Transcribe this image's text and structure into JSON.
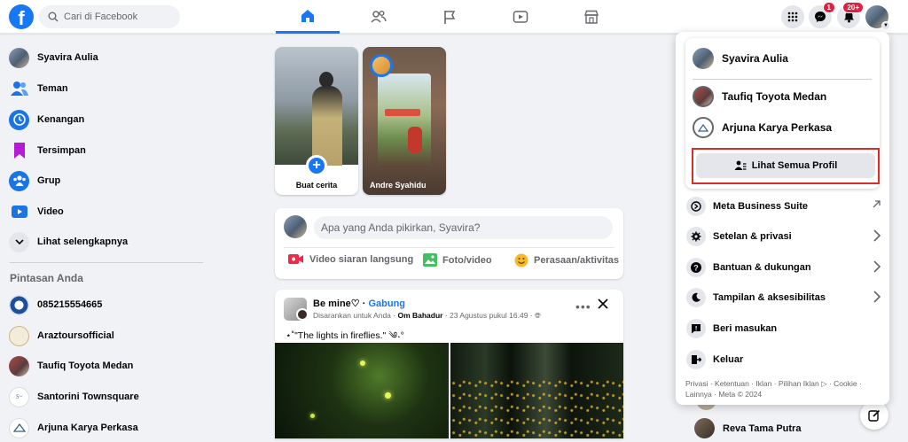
{
  "header": {
    "logo": "f",
    "search_placeholder": "Cari di Facebook",
    "messenger_badge": "1",
    "notif_badge": "20+"
  },
  "left_nav": {
    "items": [
      {
        "label": "Syavira Aulia",
        "icon": "profile-avatar"
      },
      {
        "label": "Teman",
        "icon": "friends-icon"
      },
      {
        "label": "Kenangan",
        "icon": "memories-icon"
      },
      {
        "label": "Tersimpan",
        "icon": "saved-icon"
      },
      {
        "label": "Grup",
        "icon": "groups-icon"
      },
      {
        "label": "Video",
        "icon": "video-icon"
      },
      {
        "label": "Lihat selengkapnya",
        "icon": "chevron-down-icon"
      }
    ],
    "shortcuts_title": "Pintasan Anda",
    "shortcuts": [
      {
        "label": "085215554665"
      },
      {
        "label": "Araztoursofficial"
      },
      {
        "label": "Taufiq Toyota Medan"
      },
      {
        "label": "Santorini Townsquare"
      },
      {
        "label": "Arjuna Karya Perkasa"
      }
    ]
  },
  "stories": [
    {
      "label": "Buat cerita"
    },
    {
      "label": "Andre Syahidu"
    }
  ],
  "composer": {
    "placeholder": "Apa yang Anda pikirkan, Syavira?",
    "actions": [
      {
        "label": "Video siaran langsung",
        "color": "#f02849"
      },
      {
        "label": "Foto/video",
        "color": "#45bd62"
      },
      {
        "label": "Perasaan/aktivitas",
        "color": "#f7b928"
      }
    ]
  },
  "post": {
    "author": "Be mine♡",
    "join_label": "Gabung",
    "meta_prefix": "Disarankan untuk Anda",
    "meta_author": "Om Bahadur",
    "meta_date": "23 Agustus pukul 16.49",
    "text": "⋆˚\"The lights in fireflies.\" ༄˖°"
  },
  "menu": {
    "current_profile": "Syavira Aulia",
    "profiles": [
      "Taufiq Toyota Medan",
      "Arjuna Karya Perkasa"
    ],
    "see_all_profiles": "Lihat Semua Profil",
    "items": [
      {
        "label": "Meta Business Suite",
        "icon": "meta-business-icon",
        "arrow": "external"
      },
      {
        "label": "Setelan & privasi",
        "icon": "gear-icon",
        "arrow": "chevron"
      },
      {
        "label": "Bantuan & dukungan",
        "icon": "help-icon",
        "arrow": "chevron"
      },
      {
        "label": "Tampilan & aksesibilitas",
        "icon": "moon-icon",
        "arrow": "chevron"
      },
      {
        "label": "Beri masukan",
        "icon": "feedback-icon",
        "arrow": "none"
      },
      {
        "label": "Keluar",
        "icon": "logout-icon",
        "arrow": "none"
      }
    ],
    "footer": "Privasi · Ketentuan · Iklan · Pilihan Iklan ▷ · Cookie · Lainnya · Meta © 2024"
  },
  "right_contacts": [
    {
      "label": "Reva Tama Putra"
    }
  ],
  "colors": {
    "accent": "#1877f2",
    "highlight_border": "#d32f2f",
    "badge": "#e41e3f"
  }
}
